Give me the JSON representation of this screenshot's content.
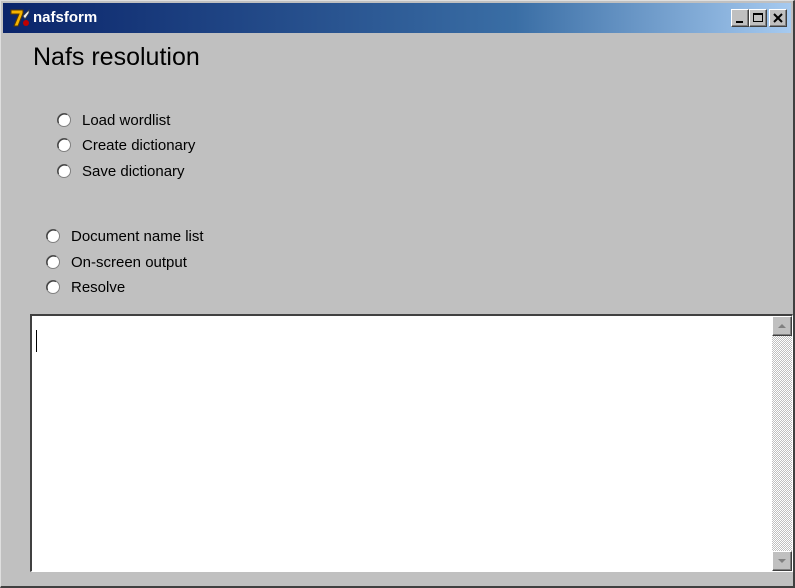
{
  "window": {
    "title": "nafsform",
    "icon": "delphi-app-icon",
    "controls": [
      "minimize-icon",
      "maximize-icon",
      "close-icon"
    ],
    "titlebar_colors": [
      "#0a246a",
      "#a6caf0"
    ]
  },
  "page": {
    "title": "Nafs resolution"
  },
  "dictionary_group": {
    "options": [
      {
        "label": "Load wordlist",
        "checked": false
      },
      {
        "label": "Create dictionary",
        "checked": false
      },
      {
        "label": "Save dictionary",
        "checked": false
      }
    ]
  },
  "output_group": {
    "options": [
      {
        "label": "Document name list",
        "checked": false
      },
      {
        "label": "On-screen output",
        "checked": false
      },
      {
        "label": "Resolve",
        "checked": false
      }
    ]
  },
  "memo": {
    "value": "",
    "scrollbar_icons": [
      "scroll-up-arrow-icon",
      "scroll-down-arrow-icon"
    ]
  }
}
